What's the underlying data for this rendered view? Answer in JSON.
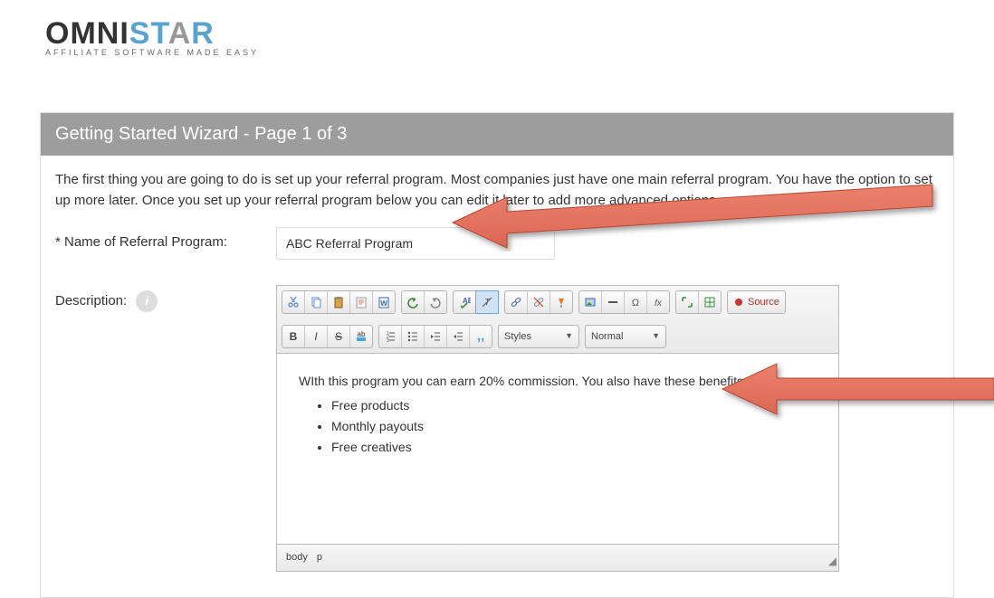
{
  "brand": {
    "part1": "OMNI",
    "part2": "ST",
    "part3": "A",
    "part4": "R",
    "tagline": "AFFILIATE SOFTWARE MADE EASY"
  },
  "header": "Getting Started Wizard - Page 1 of 3",
  "intro": "The first thing you are going to do is set up your referral program. Most companies just have one main referral program. You have the option to set up more later. Once you set up your referral program below you can edit it later to add more advanced options.",
  "form": {
    "name_label": "* Name of Referral Program:",
    "name_value": "ABC Referral Program",
    "desc_label": "Description:"
  },
  "editor": {
    "styles_label": "Styles",
    "format_label": "Normal",
    "source_label": "Source",
    "content_line": "WIth this program you can earn 20% commission. You also have these benefits:",
    "bullets": [
      "Free products",
      "Monthly payouts",
      "Free creatives"
    ],
    "path_body": "body",
    "path_p": "p"
  }
}
